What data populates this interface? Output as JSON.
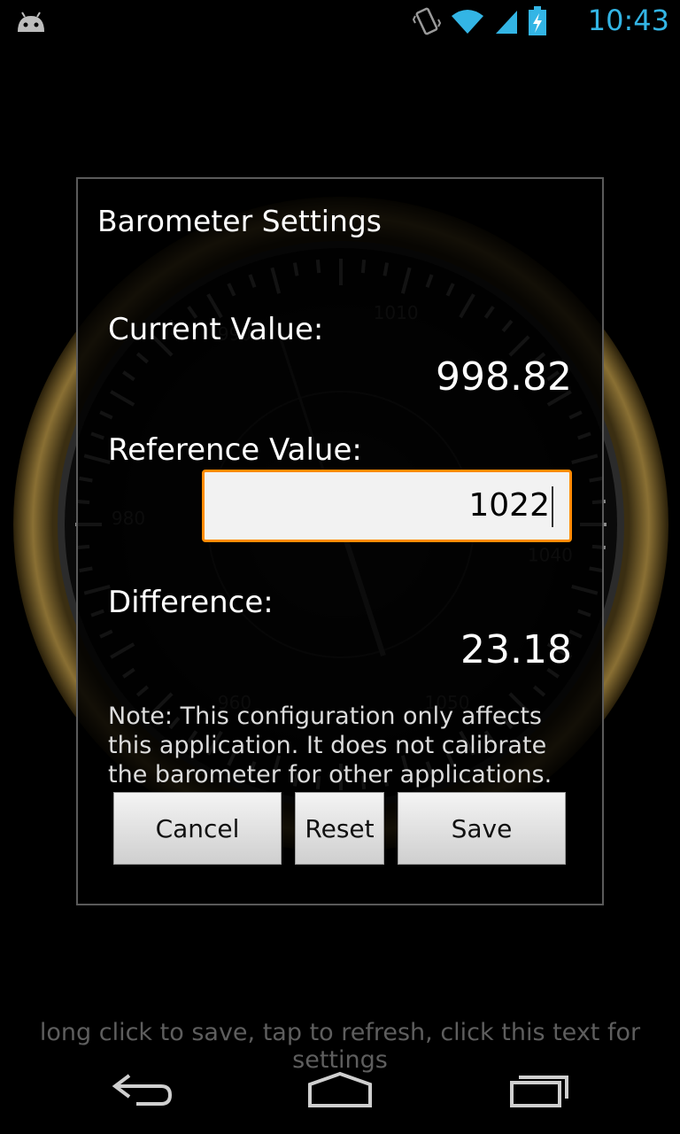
{
  "status_bar": {
    "time": "10:43",
    "icons": [
      "android-debug-icon",
      "vibrate-icon",
      "wifi-icon",
      "cell-signal-icon",
      "battery-charging-icon"
    ],
    "time_color": "#33b5e5"
  },
  "dialog": {
    "title": "Barometer Settings",
    "current_label": "Current Value:",
    "current_value": "998.82",
    "reference_label": "Reference Value:",
    "reference_value": "1022",
    "difference_label": "Difference:",
    "difference_value": "23.18",
    "note": "Note: This configuration only affects this application. It does not calibrate the barometer for other applications.",
    "buttons": {
      "cancel": "Cancel",
      "reset": "Reset",
      "save": "Save"
    },
    "input_border_color": "#ff8c00"
  },
  "gauge": {
    "tick_labels": [
      "990",
      "1010",
      "980",
      "1040",
      "1050",
      "960"
    ]
  },
  "hint_text": "long click to save, tap to refresh, click this text for settings",
  "nav": {
    "icons": [
      "back-icon",
      "home-icon",
      "recent-apps-icon"
    ]
  }
}
